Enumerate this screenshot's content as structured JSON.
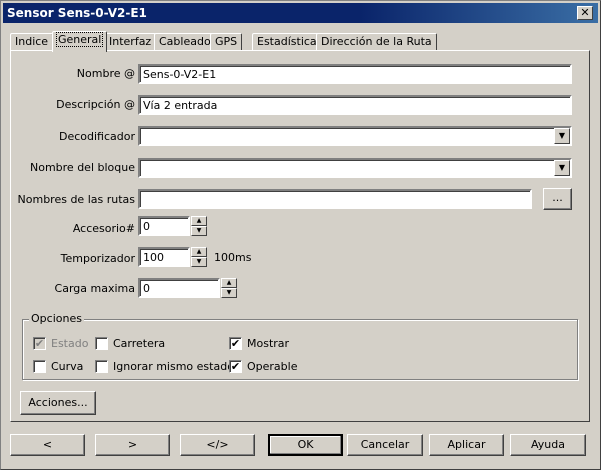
{
  "window": {
    "title": "Sensor Sens-0-V2-E1",
    "close_glyph": "✕"
  },
  "tabs": [
    {
      "label": "Indice"
    },
    {
      "label": "General"
    },
    {
      "label": "Interfaz"
    },
    {
      "label": "Cableado"
    },
    {
      "label": "GPS"
    },
    {
      "label": "Estadística"
    },
    {
      "label": "Dirección de la Ruta"
    }
  ],
  "form": {
    "nombre": {
      "label": "Nombre @",
      "value": "Sens-0-V2-E1"
    },
    "descripcion": {
      "label": "Descripción @",
      "value": "Vía 2 entrada"
    },
    "decodificador": {
      "label": "Decodificador",
      "value": ""
    },
    "nombre_bloque": {
      "label": "Nombre del bloque",
      "value": ""
    },
    "nombres_rutas": {
      "label": "Nombres de las rutas",
      "value": "",
      "browse_label": "..."
    },
    "accesorio": {
      "label": "Accesorio#",
      "value": "0"
    },
    "temporizador": {
      "label": "Temporizador",
      "value": "100",
      "unit": "100ms"
    },
    "carga_maxima": {
      "label": "Carga maxima",
      "value": "0"
    }
  },
  "opciones": {
    "title": "Opciones",
    "estado": {
      "label": "Estado",
      "checked": true,
      "enabled": false
    },
    "carretera": {
      "label": "Carretera",
      "checked": false
    },
    "mostrar": {
      "label": "Mostrar",
      "checked": true
    },
    "curva": {
      "label": "Curva",
      "checked": false
    },
    "ignorar": {
      "label": "Ignorar mismo estado",
      "checked": false
    },
    "operable": {
      "label": "Operable",
      "checked": true
    }
  },
  "acciones_label": "Acciones...",
  "footer": {
    "prev": "<",
    "next": ">",
    "code": "</>",
    "ok": "OK",
    "cancel": "Cancelar",
    "apply": "Aplicar",
    "help": "Ayuda"
  },
  "check_glyph": "✔",
  "arrow_down": "▼",
  "arrow_up_small": "▲",
  "arrow_down_small": "▼"
}
